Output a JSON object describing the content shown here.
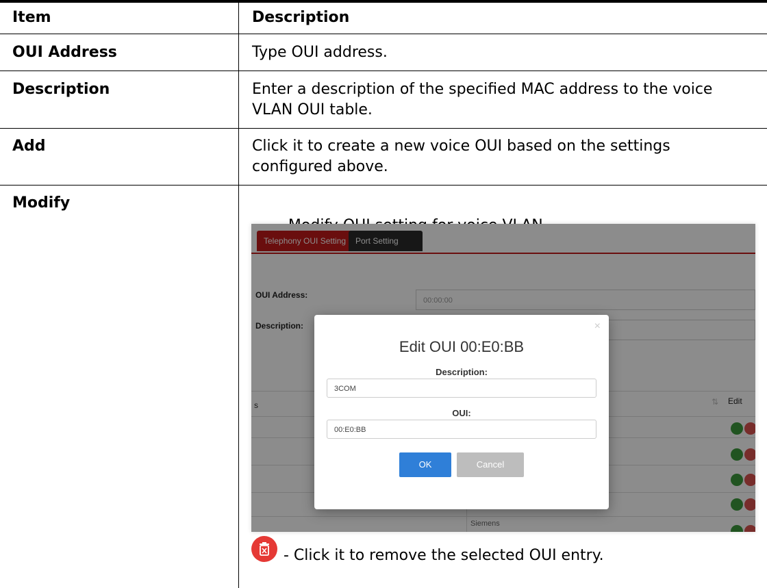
{
  "table": {
    "header": {
      "item": "Item",
      "description": "Description"
    },
    "rows": [
      {
        "item": "OUI Address",
        "desc_lines": [
          "Type OUI address."
        ]
      },
      {
        "item": "Description",
        "desc_lines": [
          "Enter a description of the specified MAC address to the voice",
          "VLAN OUI table."
        ]
      },
      {
        "item": "Add",
        "desc_lines": [
          "Click it to create a new voice OUI based on the settings",
          "configured above."
        ]
      },
      {
        "item": "Modify",
        "desc_lines": [
          "- Modify OUI setting for voice VLAN.",
          "- Click it to remove the selected OUI entry."
        ]
      }
    ]
  },
  "screenshot": {
    "tabs": [
      "Telephony OUI Setting",
      "Port Setting"
    ],
    "form": {
      "oui_label": "OUI Address:",
      "oui_value": "00:00:00",
      "desc_label": "Description:"
    },
    "table": {
      "edit_header": "Edit",
      "partial_header": "s",
      "last_row_text": "Siemens"
    },
    "modal": {
      "title": "Edit OUI 00:E0:BB",
      "desc_label": "Description:",
      "desc_value": "3COM",
      "oui_label": "OUI:",
      "oui_value": "00:E0:BB",
      "ok": "OK",
      "cancel": "Cancel",
      "close": "×"
    }
  },
  "icons": {
    "wrench": "wrench-icon",
    "trash": "trash-icon"
  },
  "colors": {
    "wrench_green": "#3c9a3c",
    "trash_red": "#e53935",
    "tab_red": "#c21b1b",
    "ok_blue": "#2f7fd8"
  }
}
